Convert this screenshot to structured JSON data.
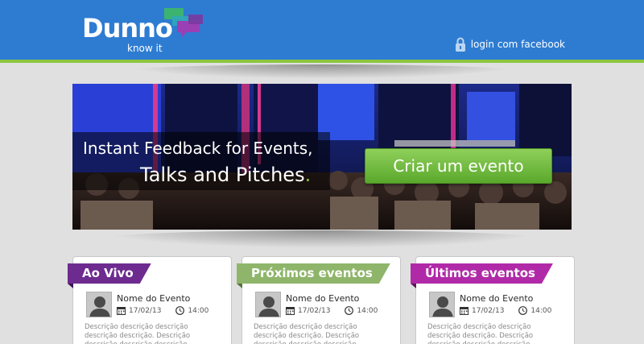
{
  "header": {
    "logo_word": "Dunno",
    "logo_tagline": "know it",
    "login_label": "login com facebook",
    "colors": {
      "header_bg": "#2e7cd2",
      "accent_green": "#8cc63f"
    }
  },
  "hero": {
    "line1": "Instant Feedback for Events,",
    "line2": "Talks and Pitches",
    "line2_end": ".",
    "cta_label": "Criar um evento"
  },
  "cards": [
    {
      "title": "Ao Vivo",
      "tab_color": "#6d2b8f",
      "event_name": "Nome do Evento",
      "date": "17/02/13",
      "time": "14:00",
      "description": "Descrição descrição descrição descrição descrição. Descrição descrição descrição descrição descrição"
    },
    {
      "title": "Próximos eventos",
      "tab_color": "#8fb56a",
      "event_name": "Nome do Evento",
      "date": "17/02/13",
      "time": "14:00",
      "description": "Descrição descrição descrição descrição descrição. Descrição descrição descrição descrição descrição"
    },
    {
      "title": "Últimos eventos",
      "tab_color": "#b02aa8",
      "event_name": "Nome do Evento",
      "date": "17/02/13",
      "time": "14:00",
      "description": "Descrição descrição descrição descrição descrição. Descrição descrição descrição descrição descrição"
    }
  ],
  "icons": {
    "login": "lock-icon",
    "avatar": "user-avatar-icon",
    "date": "calendar-icon",
    "time": "clock-icon"
  }
}
